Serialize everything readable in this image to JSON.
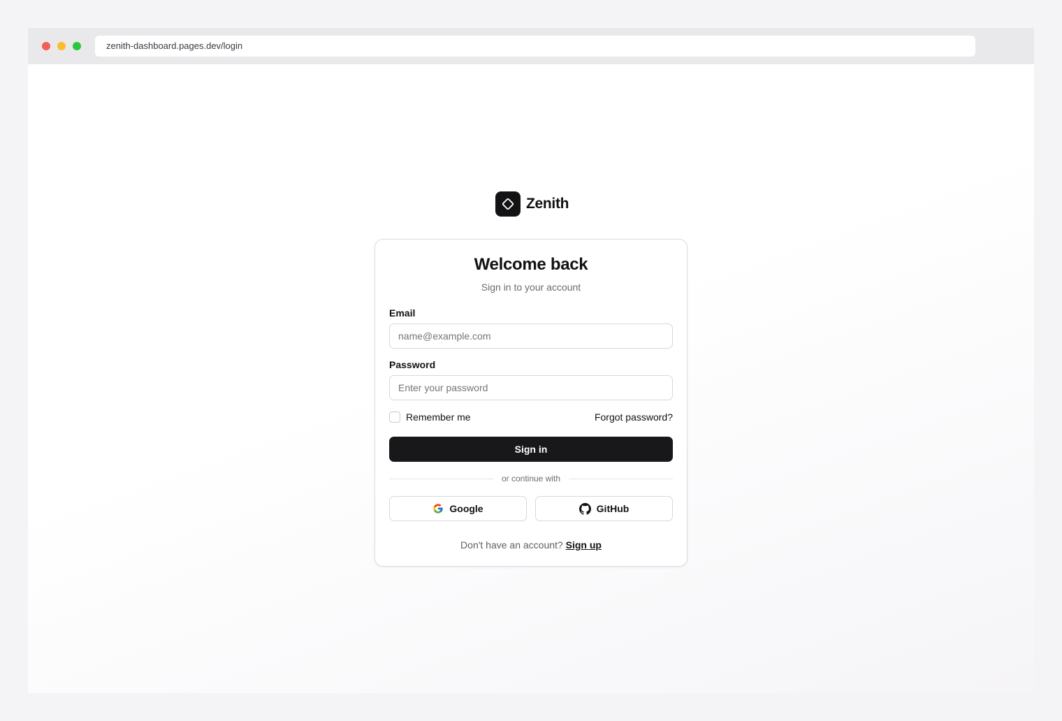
{
  "browser": {
    "url": "zenith-dashboard.pages.dev/login"
  },
  "brand": {
    "name": "Zenith",
    "logo_icon": "diamond-icon"
  },
  "card": {
    "title": "Welcome back",
    "subtitle": "Sign in to your account"
  },
  "form": {
    "email_label": "Email",
    "email_placeholder": "name@example.com",
    "email_value": "",
    "password_label": "Password",
    "password_placeholder": "Enter your password",
    "password_value": "",
    "remember_label": "Remember me",
    "remember_checked": false,
    "forgot_label": "Forgot password?",
    "signin_label": "Sign in"
  },
  "divider": {
    "text": "or continue with"
  },
  "social": {
    "google_label": "Google",
    "github_label": "GitHub"
  },
  "footer": {
    "prompt": "Don't have an account?",
    "signup_label": "Sign up"
  },
  "colors": {
    "primary": "#18181b",
    "background": "#f4f4f6",
    "card_border": "#dddde1",
    "muted_text": "#6b6b72"
  }
}
